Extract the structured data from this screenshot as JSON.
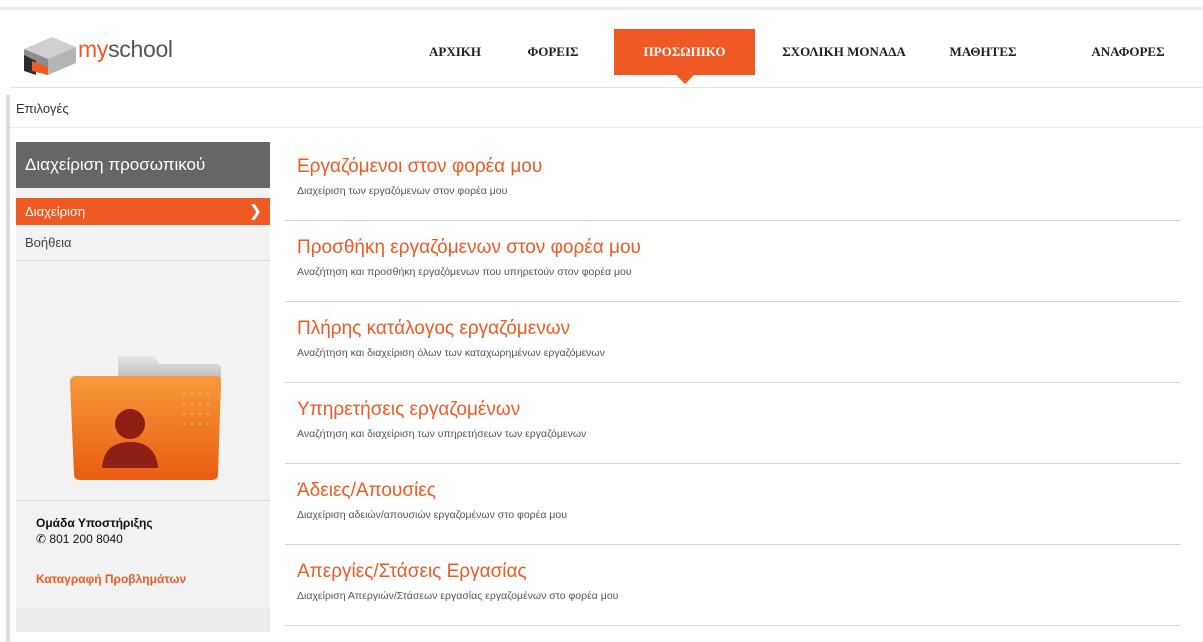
{
  "brand": {
    "part1": "my",
    "part2": "school"
  },
  "nav": {
    "items": [
      {
        "label": "ΑΡΧΙΚΗ"
      },
      {
        "label": "ΦΟΡΕΙΣ"
      },
      {
        "label": "ΠΡΟΣΩΠΙΚΟ",
        "active": true
      },
      {
        "label": "ΣΧΟΛΙΚΗ ΜΟΝΑΔΑ"
      },
      {
        "label": "ΜΑΘΗΤΕΣ"
      },
      {
        "label": "ΑΝΑΦΟΡΕΣ"
      }
    ]
  },
  "breadcrumb": "Επιλογές",
  "sidebar": {
    "title": "Διαχείριση προσωπικού",
    "items": [
      {
        "label": "Διαχείριση",
        "active": true
      },
      {
        "label": "Βοήθεια"
      }
    ],
    "support": {
      "title": "Ομάδα Υποστήριξης",
      "phone": "801 200 8040",
      "link": "Καταγραφή Προβλημάτων"
    }
  },
  "entries": [
    {
      "title": "Εργαζόμενοι στον φορέα μου",
      "desc": "Διαχείριση των εργαζόμενων στον φορέα μου"
    },
    {
      "title": "Προσθήκη εργαζόμενων στον φορέα μου",
      "desc": "Αναζήτηση και προσθήκη εργαζόμενων που υπηρετούν στον φορέα μου"
    },
    {
      "title": "Πλήρης κατάλογος εργαζόμενων",
      "desc": "Αναζήτηση και διαχείριση όλων των καταχωρημένων εργαζόμενων"
    },
    {
      "title": "Υπηρετήσεις εργαζομένων",
      "desc": "Αναζήτηση και διαχείριση των υπηρετήσεων των εργαζόμενων"
    },
    {
      "title": "Άδειες/Απουσίες",
      "desc": "Διαχείριση αδειών/απουσιών εργαζομένων στο φορέα μου"
    },
    {
      "title": "Απεργίες/Στάσεις Εργασίας",
      "desc": "Διαχείριση Απεργιών/Στάσεων εργασίας εργαζομένων στο φορέα μου"
    }
  ],
  "colors": {
    "accent": "#ef5a24",
    "sidebar_head": "#666666"
  },
  "icons": {
    "phone": "phone-icon",
    "chevron": "chevron-right-icon",
    "folder": "user-folder-icon",
    "logo": "myschool-logo-icon"
  }
}
